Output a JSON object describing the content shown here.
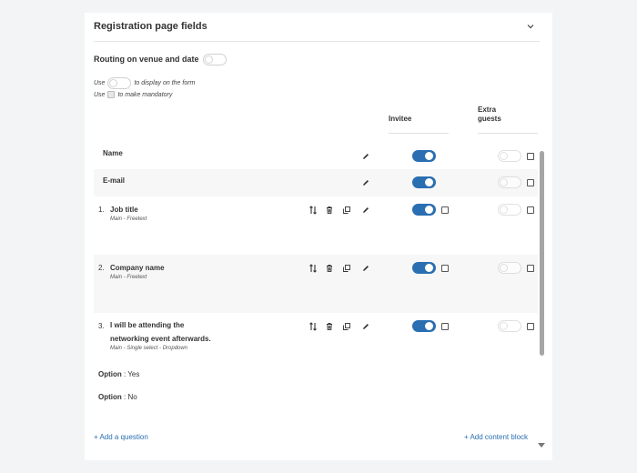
{
  "panel": {
    "title": "Registration page fields",
    "routing_label": "Routing on venue and date",
    "routing_toggle": "off"
  },
  "legend": {
    "line1_use": "Use",
    "line1_rest": "to display on the form",
    "line2_use": "Use",
    "line2_rest": "to make mandatory"
  },
  "columns": {
    "invitee": "Invitee",
    "extra_guests": "Extra guests"
  },
  "rows": [
    {
      "number": "",
      "title": "Name",
      "subtitle": "",
      "invitee_on": true,
      "extra_on": false
    },
    {
      "number": "",
      "title": "E-mail",
      "subtitle": "",
      "invitee_on": true,
      "extra_on": false
    },
    {
      "number": "1.",
      "title": "Job title",
      "subtitle": "Main - Freetext",
      "invitee_on": true,
      "extra_on": false
    },
    {
      "number": "2.",
      "title": "Company name",
      "subtitle": "Main - Freetext",
      "invitee_on": true,
      "extra_on": false
    },
    {
      "number": "3.",
      "title_line1": "I will be attending the",
      "title_line2": "networking event afterwards.",
      "subtitle": "Main - Single select - Dropdown",
      "invitee_on": true,
      "extra_on": false
    }
  ],
  "options": [
    {
      "label": "Option",
      "value": ": Yes"
    },
    {
      "label": "Option",
      "value": ": No"
    }
  ],
  "links": {
    "add_question": "+ Add a question",
    "add_content_block": "+ Add content block"
  },
  "icons": [
    "chevron-down-icon",
    "reorder-icon",
    "trash-icon",
    "copy-icon",
    "pencil-icon"
  ],
  "colors": {
    "accent": "#2a6fb1",
    "toggle_off_border": "#d0d0d0"
  }
}
